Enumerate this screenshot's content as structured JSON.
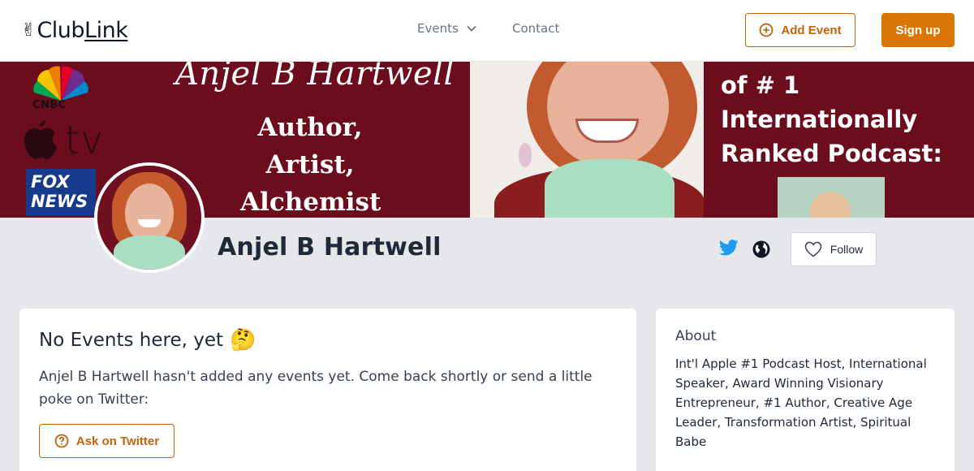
{
  "header": {
    "logo_hand": "✌",
    "logo_club": "Club",
    "logo_link": "Link",
    "nav_events": "Events",
    "nav_contact": "Contact",
    "add_event_label": "Add Event",
    "signup_label": "Sign up"
  },
  "banner": {
    "title": "Anjel B Hartwell",
    "tagline": [
      "Author,",
      "Artist,",
      "Alchemist"
    ],
    "cnbc": "CNBC",
    "tv": "tv",
    "fox": [
      "FOX",
      "NEWS"
    ],
    "right_lines": [
      "of # 1",
      "Internationally",
      "Ranked Podcast:"
    ]
  },
  "profile": {
    "name": "Anjel B Hartwell",
    "follow_label": "Follow"
  },
  "events": {
    "title": "No Events here, yet",
    "emoji": "🤔",
    "message": "Anjel B Hartwell hasn't added any events yet. Come back shortly or send a little poke on Twitter:",
    "ask_label": "Ask on Twitter"
  },
  "about": {
    "title": "About",
    "text": "Int'l Apple #1 Podcast Host, International Speaker, Award Winning Visionary Entrepreneur, #1 Author, Creative Age Leader, Transformation Artist, Spiritual Babe"
  },
  "colors": {
    "accent": "#d97706",
    "accent_border": "#c2640a",
    "banner_bg": "#6b0d1d",
    "twitter": "#1d9bf0",
    "page_bg": "#e5e7eb"
  }
}
